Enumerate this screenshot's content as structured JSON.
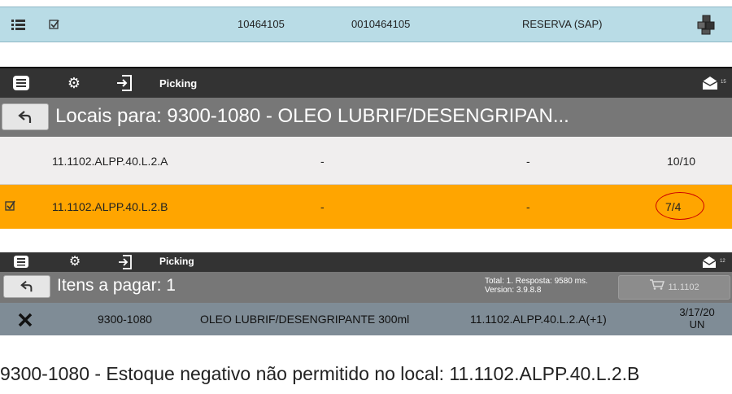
{
  "top_row": {
    "menu_icon": "list-icon",
    "check_icon": "checkbox-icon",
    "code1": "10464105",
    "code2": "0010464105",
    "type": "RESERVA (SAP)",
    "boxes_icon": "boxes-icon"
  },
  "screen1": {
    "toolbar": {
      "title": "Picking",
      "badge": "15"
    },
    "title": "Locais para: 9300-1080 - OLEO LUBRIF/DESENGRIPAN...",
    "rows": [
      {
        "location": "11.1102.ALPP.40.L.2.A",
        "col2": "-",
        "col3": "-",
        "qty": "10/10",
        "checked": false
      },
      {
        "location": "11.1102.ALPP.40.L.2.B",
        "col2": "-",
        "col3": "-",
        "qty": "7/4",
        "checked": true
      }
    ]
  },
  "screen2": {
    "toolbar": {
      "title": "Picking",
      "badge": "12"
    },
    "title": "Itens a pagar: 1",
    "status_line1": "Total: 1. Resposta: 9580 ms.",
    "status_line2": "Version: 3.9.8.8",
    "cart_label": "11.1102",
    "item": {
      "code": "9300-1080",
      "description": "OLEO LUBRIF/DESENGRIPANTE 300ml",
      "location": "11.1102.ALPP.40.L.2.A(+1)",
      "date": "3/17/20",
      "unit": "UN"
    }
  },
  "error_message": "9300-1080 - Estoque negativo não permitido no local: 11.1102.ALPP.40.L.2.B",
  "colors": {
    "highlight": "#ffa500",
    "toolbar": "#333333",
    "titlebar": "#777777",
    "row_light": "#f0eeee",
    "annotation": "#cc0000"
  }
}
